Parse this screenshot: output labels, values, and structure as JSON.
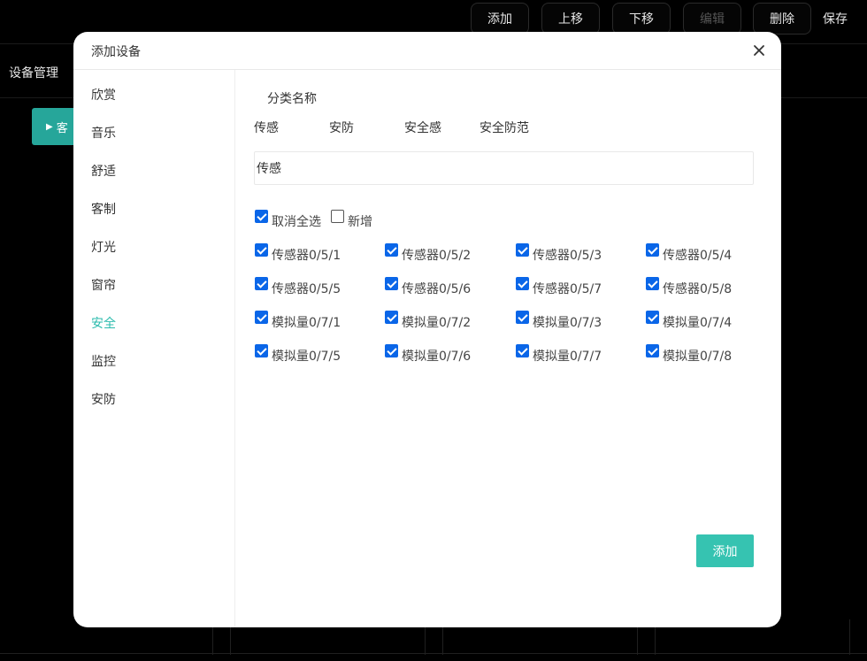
{
  "toolbar": {
    "buttons": [
      {
        "label": "添加",
        "disabled": false
      },
      {
        "label": "上移",
        "disabled": false
      },
      {
        "label": "下移",
        "disabled": false
      },
      {
        "label": "编辑",
        "disabled": true
      },
      {
        "label": "删除",
        "disabled": false
      }
    ],
    "save_label": "保存"
  },
  "app": {
    "title": "设备管理",
    "room_button_label": "客"
  },
  "modal": {
    "title": "添加设备",
    "sidebar": {
      "items": [
        "欣赏",
        "音乐",
        "舒适",
        "客制",
        "灯光",
        "窗帘",
        "安全",
        "监控",
        "安防"
      ],
      "active_index": 6
    },
    "category_label": "分类名称",
    "categories": [
      "传感",
      "安防",
      "安全感",
      "安全防范"
    ],
    "name_value": "传感",
    "select_all": {
      "label": "取消全选",
      "checked": true
    },
    "add_new": {
      "label": "新增",
      "checked": false
    },
    "devices": [
      {
        "label": "传感器0/5/1",
        "checked": true
      },
      {
        "label": "传感器0/5/2",
        "checked": true
      },
      {
        "label": "传感器0/5/3",
        "checked": true
      },
      {
        "label": "传感器0/5/4",
        "checked": true
      },
      {
        "label": "传感器0/5/5",
        "checked": true
      },
      {
        "label": "传感器0/5/6",
        "checked": true
      },
      {
        "label": "传感器0/5/7",
        "checked": true
      },
      {
        "label": "传感器0/5/8",
        "checked": true
      },
      {
        "label": "模拟量0/7/1",
        "checked": true
      },
      {
        "label": "模拟量0/7/2",
        "checked": true
      },
      {
        "label": "模拟量0/7/3",
        "checked": true
      },
      {
        "label": "模拟量0/7/4",
        "checked": true
      },
      {
        "label": "模拟量0/7/5",
        "checked": true
      },
      {
        "label": "模拟量0/7/6",
        "checked": true
      },
      {
        "label": "模拟量0/7/7",
        "checked": true
      },
      {
        "label": "模拟量0/7/8",
        "checked": true
      }
    ],
    "add_button_label": "添加"
  },
  "colors": {
    "accent": "#2bbbad",
    "button": "#36c3b1",
    "checkbox": "#0a66e8",
    "room_button": "#26a69a"
  }
}
